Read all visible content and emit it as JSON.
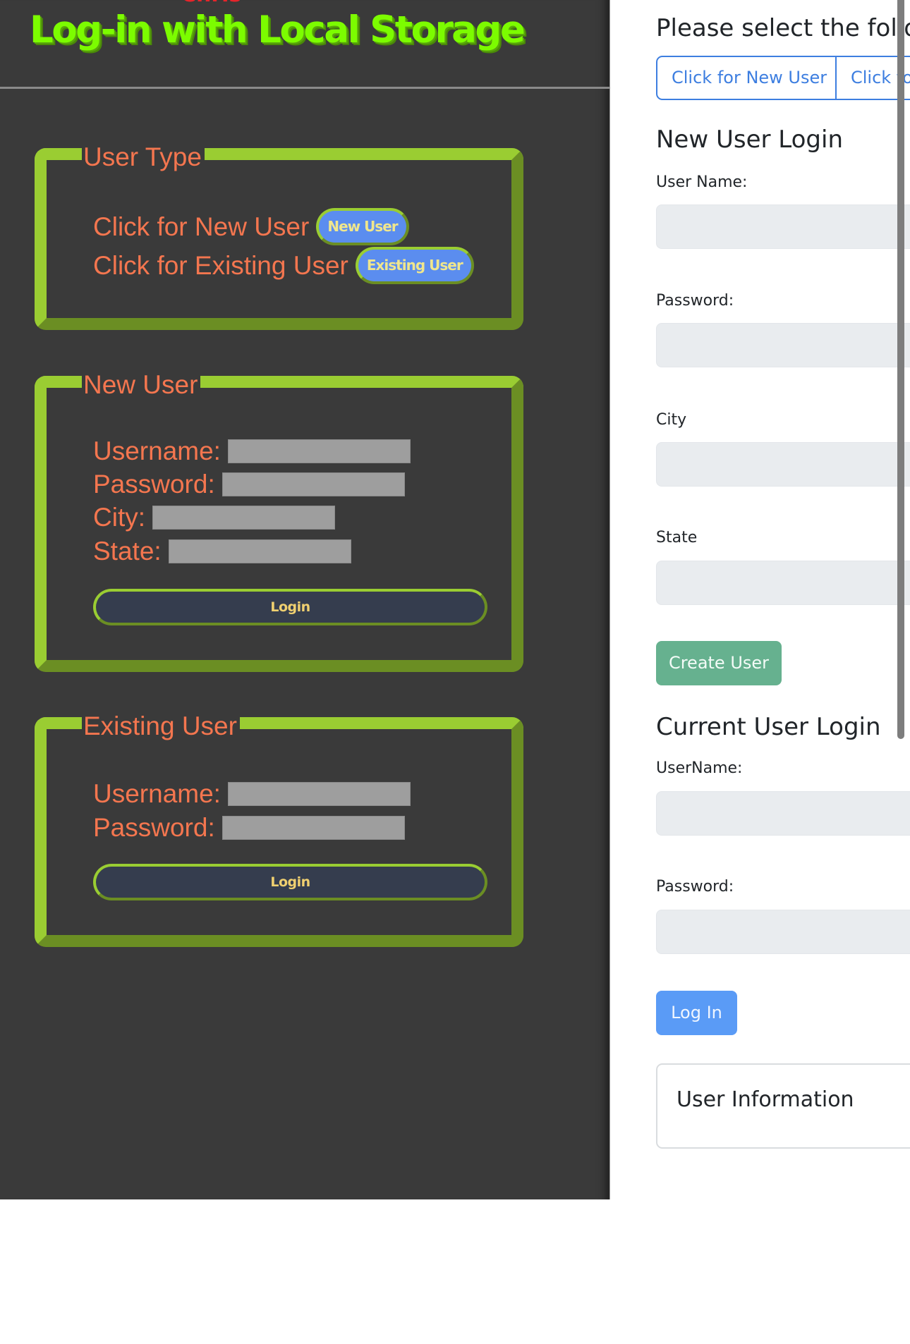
{
  "left": {
    "clipped_text": "Chris",
    "title": "Log-in with Local Storage",
    "user_type": {
      "legend": "User Type",
      "rows": [
        {
          "label": "Click for New User",
          "button": "New User"
        },
        {
          "label": "Click for Existing User",
          "button": "Existing User"
        }
      ]
    },
    "new_user": {
      "legend": "New User",
      "fields": [
        {
          "label": "Username:",
          "value": ""
        },
        {
          "label": "Password:",
          "value": ""
        },
        {
          "label": "City:",
          "value": ""
        },
        {
          "label": "State:",
          "value": ""
        }
      ],
      "login_label": "Login"
    },
    "existing_user": {
      "legend": "Existing User",
      "fields": [
        {
          "label": "Username:",
          "value": ""
        },
        {
          "label": "Password:",
          "value": ""
        }
      ],
      "login_label": "Login"
    }
  },
  "right": {
    "heading": "Please select the follo",
    "toggle_buttons": [
      "Click for New User",
      "Click fo"
    ],
    "new_user_section": {
      "title": "New User Login",
      "fields": [
        {
          "label": "User Name:",
          "value": ""
        },
        {
          "label": "Password:",
          "value": ""
        },
        {
          "label": "City",
          "value": ""
        },
        {
          "label": "State",
          "value": ""
        }
      ],
      "submit_label": "Create User"
    },
    "current_user_section": {
      "title": "Current User Login",
      "fields": [
        {
          "label": "UserName:",
          "value": ""
        },
        {
          "label": "Password:",
          "value": ""
        }
      ],
      "submit_label": "Log In"
    },
    "info_card_title": "User Information"
  },
  "colors": {
    "panel_bg": "#3a3a3a",
    "title_green": "#7cfc00",
    "label_orange": "#f4764f",
    "border_green_light": "#9acd32",
    "border_green_dark": "#6b8e23",
    "pill_blue": "#5b8def",
    "pill_text": "#f0e68c",
    "bootstrap_primary": "#3d7ee0",
    "success_button": "#66b18f",
    "primary_button": "#5a9bf6"
  }
}
